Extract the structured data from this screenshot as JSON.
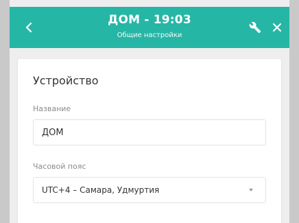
{
  "header": {
    "title": "ДОМ - 19:03",
    "subtitle": "Общие настройки",
    "back_icon": "chevron-left-icon",
    "wrench_icon": "wrench-icon",
    "close_icon": "close-icon",
    "color": "#26b6a6"
  },
  "device": {
    "section_title": "Устройство",
    "name_label": "Название",
    "name_value": "ДОМ",
    "timezone_label": "Часовой пояс",
    "timezone_value": "UTC+4 – Самара, Удмуртия"
  }
}
